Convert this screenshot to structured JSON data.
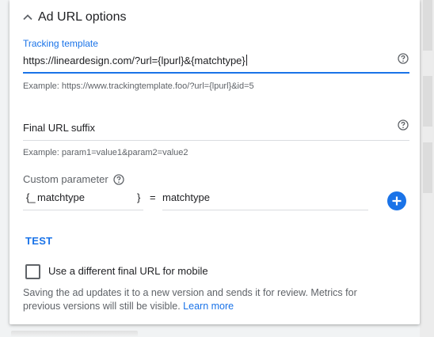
{
  "section": {
    "title": "Ad URL options"
  },
  "tracking": {
    "label": "Tracking template",
    "value": "https://lineardesign.com/?url={lpurl}&{matchtype}",
    "example": "Example: https://www.trackingtemplate.foo/?url={lpurl}&id=5"
  },
  "suffix": {
    "placeholder": "Final URL suffix",
    "example": "Example: param1=value1&param2=value2"
  },
  "custom_param": {
    "label": "Custom parameter",
    "key_prefix": "{_",
    "key": "matchtype",
    "key_suffix": "}",
    "equals": "=",
    "value": "matchtype"
  },
  "test_button": "TEST",
  "mobile_checkbox": {
    "label": "Use a different final URL for mobile",
    "checked": false
  },
  "footer": {
    "text": "Saving the ad updates it to a new version and sends it for review. Metrics for previous versions will still be visible.",
    "link": "Learn more"
  },
  "colors": {
    "accent": "#1a73e8",
    "text": "#202124",
    "muted": "#5f6368",
    "divider": "#dadce0"
  },
  "icons": [
    "chevron-up-icon",
    "help-icon",
    "plus-icon"
  ]
}
